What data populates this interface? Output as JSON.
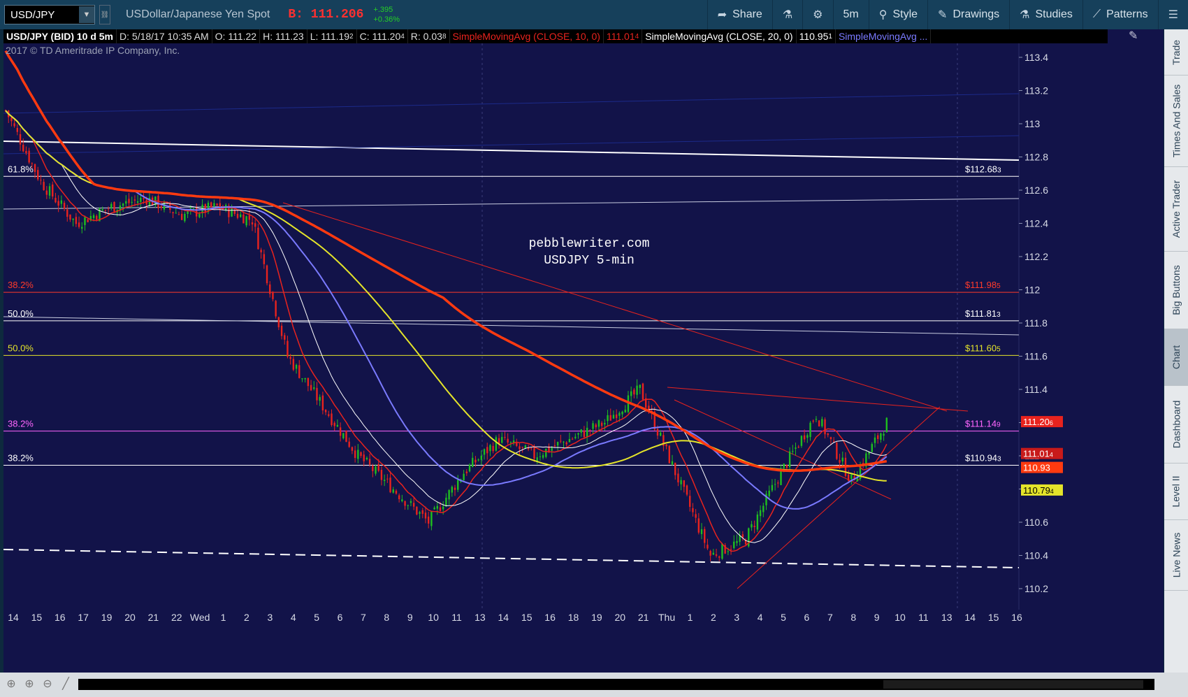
{
  "toolbar": {
    "symbol": "USD/JPY",
    "description": "USDollar/Japanese Yen Spot",
    "bid": "B: 111.206",
    "change_abs": "+.395",
    "change_pct": "+0.36%",
    "share_label": "Share",
    "timeframe_label": "5m",
    "style_label": "Style",
    "drawings_label": "Drawings",
    "studies_label": "Studies",
    "patterns_label": "Patterns"
  },
  "infobar": {
    "title": "USD/JPY (BID) 10 d 5m",
    "date": "D: 5/18/17 10:35 AM",
    "open": "O: 111.22",
    "high": "H: 111.23",
    "low": "L: 111.19",
    "low_sub": "2",
    "close": "C: 111.20",
    "close_sub": "4",
    "range": "R: 0.03",
    "range_sub": "8",
    "sma10_label": "SimpleMovingAvg (CLOSE, 10, 0)",
    "sma10_value": "111.01",
    "sma10_sub": "4",
    "sma20_label": "SimpleMovingAvg (CLOSE, 20, 0)",
    "sma20_value": "110.95",
    "sma20_sub": "1",
    "sma_more_label": "SimpleMovingAvg ..."
  },
  "copyright": "2017 © TD Ameritrade IP Company, Inc.",
  "watermark": {
    "line1": "pebblewriter.com",
    "line2": "USDJPY 5-min"
  },
  "right_tabs": [
    "Trade",
    "Times And Sales",
    "Active Trader",
    "Big Buttons",
    "Chart",
    "Dashboard",
    "Level II",
    "Live News"
  ],
  "chart_data": {
    "type": "candlestick",
    "series": [
      {
        "name": "USD/JPY (BID) 10 d 5m",
        "color": "#1fbf1f",
        "approx_close_path": [
          [
            0,
            113.08
          ],
          [
            3,
            112.65
          ],
          [
            6,
            112.4
          ],
          [
            9,
            112.5
          ],
          [
            10,
            112.55
          ],
          [
            11,
            112.45
          ],
          [
            12,
            112.5
          ],
          [
            13,
            112.42
          ],
          [
            14,
            111.6
          ],
          [
            15,
            111.3
          ],
          [
            16,
            111.0
          ],
          [
            17,
            110.8
          ],
          [
            18,
            110.6
          ],
          [
            19,
            110.9
          ],
          [
            20,
            111.1
          ],
          [
            21,
            111.0
          ],
          [
            22,
            111.1
          ],
          [
            23,
            111.2
          ],
          [
            24,
            111.4
          ],
          [
            25,
            110.9
          ],
          [
            26,
            110.4
          ],
          [
            27,
            110.5
          ],
          [
            28,
            110.9
          ],
          [
            29,
            111.25
          ],
          [
            30,
            110.85
          ],
          [
            31,
            111.2
          ]
        ]
      },
      {
        "name": "SimpleMovingAvg (CLOSE, 10, 0)",
        "color": "#e8231e",
        "last": 111.014
      },
      {
        "name": "SimpleMovingAvg (CLOSE, 20, 0)",
        "color": "#ffffff",
        "last": 110.951
      },
      {
        "name": "SimpleMovingAvg",
        "color": "#7a7aff"
      },
      {
        "name": "SimpleMovingAvg",
        "color": "#e4e42a",
        "last": 110.794
      },
      {
        "name": "SimpleMovingAvg",
        "color": "#ff3a10",
        "last": 110.93
      }
    ],
    "yaxis": {
      "ticks": [
        "113.4",
        "113.2",
        "113",
        "112.8",
        "112.6",
        "112.4",
        "112.2",
        "112",
        "111.8",
        "111.6",
        "111.4",
        "111.2",
        "111",
        "110.8",
        "110.6",
        "110.4",
        "110.2"
      ],
      "range": [
        110.1,
        113.55
      ]
    },
    "xaxis": {
      "ticks": [
        "14",
        "15",
        "16",
        "17",
        "19",
        "20",
        "21",
        "22",
        "Wed",
        "1",
        "2",
        "3",
        "4",
        "5",
        "6",
        "7",
        "8",
        "9",
        "10",
        "11",
        "13",
        "14",
        "15",
        "16",
        "18",
        "19",
        "20",
        "21",
        "Thu",
        "1",
        "2",
        "3",
        "4",
        "5",
        "6",
        "7",
        "8",
        "9",
        "10",
        "11",
        "13",
        "14",
        "15",
        "16"
      ]
    },
    "fib_levels": [
      {
        "label": "61.8%",
        "price": 112.683,
        "price_label": "$112.68",
        "sub": "3",
        "color": "#ffffff"
      },
      {
        "label": "38.2%",
        "price": 111.985,
        "price_label": "$111.98",
        "sub": "5",
        "color": "#ff3a2a"
      },
      {
        "label": "50.0%",
        "price": 111.813,
        "price_label": "$111.81",
        "sub": "3",
        "color": "#ffffff"
      },
      {
        "label": "50.0%",
        "price": 111.605,
        "price_label": "$111.60",
        "sub": "5",
        "color": "#e4e42a"
      },
      {
        "label": "38.2%",
        "price": 111.149,
        "price_label": "$111.14",
        "sub": "9",
        "color": "#ff66ff"
      },
      {
        "label": "38.2%",
        "price": 110.943,
        "price_label": "$110.94",
        "sub": "3",
        "color": "#ffffff"
      }
    ],
    "price_tags": [
      {
        "value": "111.20",
        "sub": "6",
        "price": 111.206,
        "bg": "#e8231e",
        "fg": "#ffffff"
      },
      {
        "value": "111.01",
        "sub": "4",
        "price": 111.014,
        "bg": "#c81a1a",
        "fg": "#ffffff"
      },
      {
        "value": "110.93",
        "sub": "",
        "price": 110.93,
        "bg": "#ff3a10",
        "fg": "#ffffff"
      },
      {
        "value": "110.79",
        "sub": "4",
        "price": 110.794,
        "bg": "#e4e42a",
        "fg": "#000000"
      }
    ]
  }
}
